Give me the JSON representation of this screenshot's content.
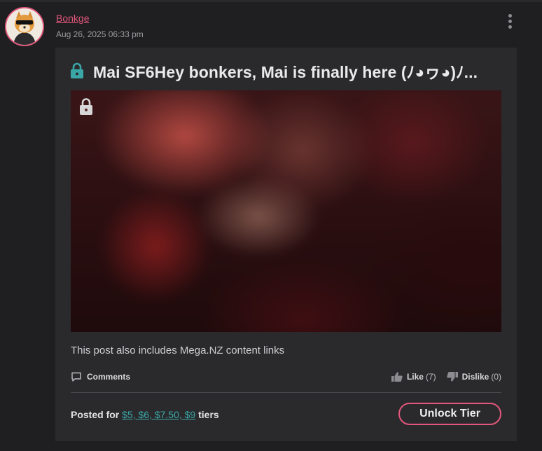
{
  "post": {
    "author": "Bonkge",
    "date": "Aug 26, 2025 06:33 pm",
    "title": "Mai SF6Hey bonkers, Mai is finally here (ﾉ◕ヮ◕)ﾉ...",
    "note": "This post also includes Mega.NZ content links"
  },
  "actions": {
    "comments_label": "Comments",
    "like_label": "Like",
    "like_count": "(7)",
    "dislike_label": "Dislike",
    "dislike_count": "(0)"
  },
  "footer": {
    "posted_prefix": "Posted for ",
    "tiers_link": "$5, $6, $7.50, $9",
    "posted_suffix": " tiers",
    "unlock_label": "Unlock Tier"
  },
  "icons": {
    "avatar": "shiba-dog-avatar",
    "menu": "kebab-menu-icon",
    "title_lock": "lock-icon",
    "media_lock": "lock-icon",
    "comments": "comment-icon",
    "like": "thumbs-up-icon",
    "dislike": "thumbs-down-icon"
  },
  "colors": {
    "accent": "#e2577b",
    "link": "#3aa7a6",
    "lock_title": "#3aa7a6",
    "background": "#1f1f21",
    "card": "#2a2a2d"
  }
}
